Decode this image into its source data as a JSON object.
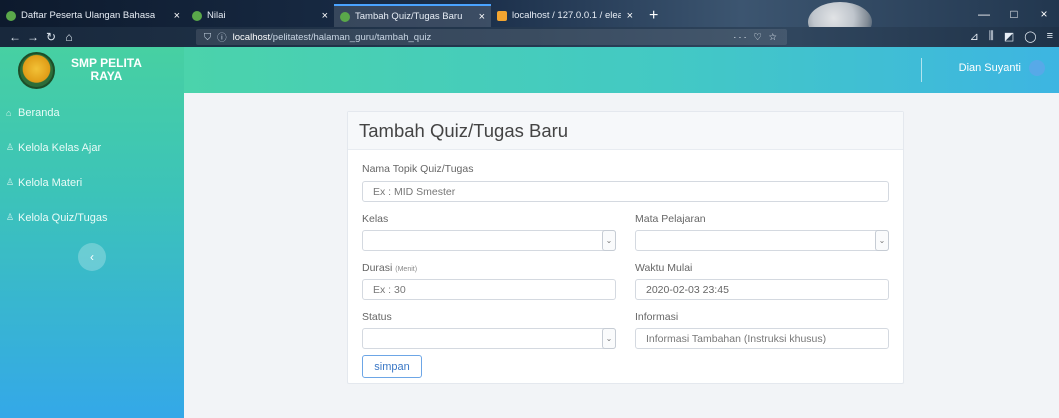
{
  "browser": {
    "tabs": [
      {
        "label": "Daftar Peserta Ulangan Bahasa",
        "close": "×"
      },
      {
        "label": "Nilai",
        "close": "×"
      },
      {
        "label": "Tambah Quiz/Tugas Baru",
        "close": "×"
      },
      {
        "label": "localhost / 127.0.0.1 / elearning",
        "close": "×"
      }
    ],
    "new_tab": "+",
    "url_host": "localhost",
    "url_path": "/pelitatest/halaman_guru/tambah_quiz",
    "url_actions": "··· ♡ ☆",
    "window_controls": [
      "—",
      "□",
      "×"
    ]
  },
  "app": {
    "brand": {
      "line1": "SMP PELITA",
      "line2": "RAYA"
    },
    "menu": [
      {
        "icon": "home-icon",
        "label": "Beranda"
      },
      {
        "icon": "user-icon",
        "label": "Kelola Kelas Ajar"
      },
      {
        "icon": "user-icon",
        "label": "Kelola Materi"
      },
      {
        "icon": "user-icon",
        "label": "Kelola Quiz/Tugas"
      }
    ],
    "collapse_glyph": "‹",
    "user_name": "Dian Suyanti"
  },
  "form": {
    "title": "Tambah Quiz/Tugas Baru",
    "topic_label": "Nama Topik Quiz/Tugas",
    "topic_placeholder": "Ex : MID Smester",
    "kelas_label": "Kelas",
    "mapel_label": "Mata Pelajaran",
    "durasi_label": "Durasi",
    "durasi_unit": "(Menit)",
    "durasi_placeholder": "Ex : 30",
    "waktu_label": "Waktu Mulai",
    "waktu_value": "2020-02-03 23:45",
    "status_label": "Status",
    "info_label": "Informasi",
    "info_placeholder": "Informasi Tambahan (Instruksi khusus)",
    "submit_label": "simpan"
  }
}
